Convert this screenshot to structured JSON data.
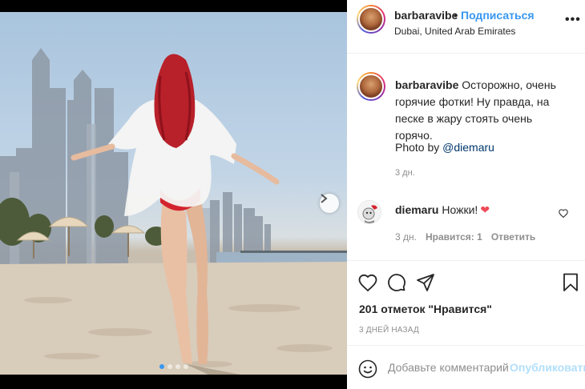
{
  "header": {
    "username": "barbaravibe",
    "separator": "•",
    "follow_label": "Подписаться",
    "location": "Dubai, United Arab Emirates",
    "more_icon": "more-horizontal-icon"
  },
  "caption": {
    "username": "barbaravibe",
    "text": "Осторожно, очень горячие фотки! Ну правда, на песке в жару стоять очень горячо.",
    "photo_by_prefix": "Photo by",
    "mention": "@diemaru",
    "time": "3 дн."
  },
  "comment": {
    "username": "diemaru",
    "text": "Ножки!",
    "emoji": "❤",
    "time": "3 дн.",
    "likes_label": "Нравится: 1",
    "reply_label": "Ответить"
  },
  "actions": {
    "likes_text": "201 отметок \"Нравится\"",
    "date_text": "3 ДНЕЙ НАЗАД"
  },
  "add_comment": {
    "placeholder": "Добавьте комментарий...",
    "publish_label": "Опубликовать"
  },
  "carousel": {
    "dot_count": 4,
    "active_index": 0
  },
  "colors": {
    "accent": "#3897f0",
    "heart": "#ed4956",
    "publish_disabled": "#b2dffc"
  }
}
